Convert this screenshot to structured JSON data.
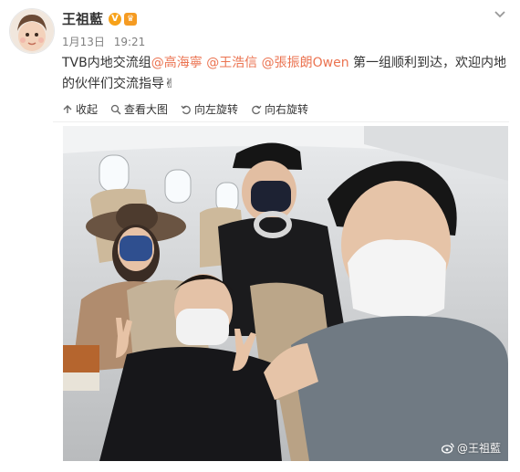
{
  "post": {
    "author_name": "王祖藍",
    "date": "1月13日",
    "time": "19:21",
    "text_lead": "TVB内地交流组",
    "mentions": [
      "@高海寧",
      "@王浩信",
      "@張振朗Owen"
    ],
    "text_rest": " 第一组顺利到达，欢迎内地的伙伴们交流指导",
    "emoji": "✌"
  },
  "toolbar": {
    "collapse_label": "收起",
    "view_large_label": "查看大图",
    "rotate_left_label": "向左旋转",
    "rotate_right_label": "向右旋转"
  },
  "badges": {
    "verified": "V"
  },
  "photo": {
    "watermark": "@王祖藍"
  },
  "colors": {
    "mention": "#eb7350",
    "verified_badge": "#f7a21a",
    "meta_text": "#808080"
  },
  "icons": [
    "chevron-down-icon",
    "collapse-icon",
    "search-icon",
    "rotate-left-icon",
    "rotate-right-icon",
    "weibo-icon"
  ]
}
